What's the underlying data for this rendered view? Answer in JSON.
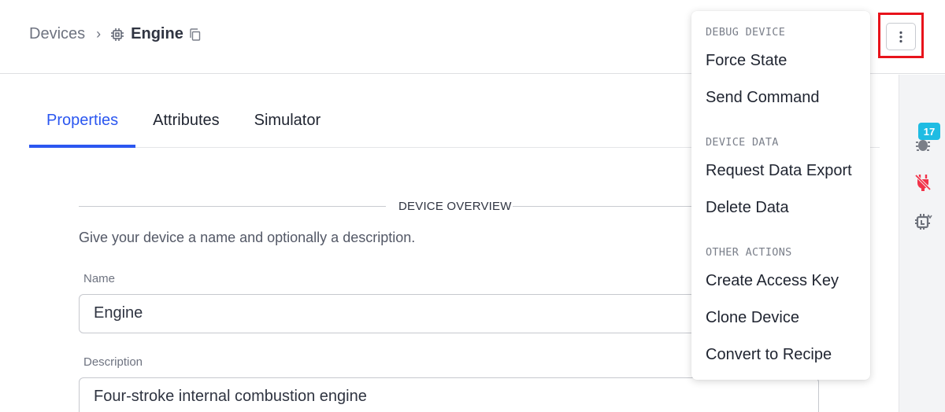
{
  "breadcrumb": {
    "root": "Devices",
    "separator": "›",
    "current": "Engine",
    "current_icon": "chip-icon",
    "copy_icon": "copy-icon"
  },
  "header": {
    "more_button_icon": "more-vertical-icon",
    "highlight_color": "#e8131b"
  },
  "tabs": [
    {
      "label": "Properties",
      "active": true
    },
    {
      "label": "Attributes",
      "active": false
    },
    {
      "label": "Simulator",
      "active": false
    }
  ],
  "accent_color": "#2b57f0",
  "form": {
    "section_title": "DEVICE OVERVIEW",
    "helper_text": "Give your device a name and optionally a description.",
    "name_label": "Name",
    "name_value": "Engine",
    "description_label": "Description",
    "description_value": "Four-stroke internal combustion engine"
  },
  "right_rail": {
    "items": [
      {
        "icon": "debug-bug-icon",
        "badge": "17",
        "badge_color": "#1fbce3"
      },
      {
        "icon": "disconnected-plug-icon",
        "color": "#f2334a"
      },
      {
        "icon": "chip-schedule-icon"
      }
    ]
  },
  "menu": {
    "groups": [
      {
        "label": "DEBUG DEVICE",
        "items": [
          "Force State",
          "Send Command"
        ]
      },
      {
        "label": "DEVICE DATA",
        "items": [
          "Request Data Export",
          "Delete Data"
        ]
      },
      {
        "label": "OTHER ACTIONS",
        "items": [
          "Create Access Key",
          "Clone Device",
          "Convert to Recipe"
        ]
      }
    ]
  }
}
